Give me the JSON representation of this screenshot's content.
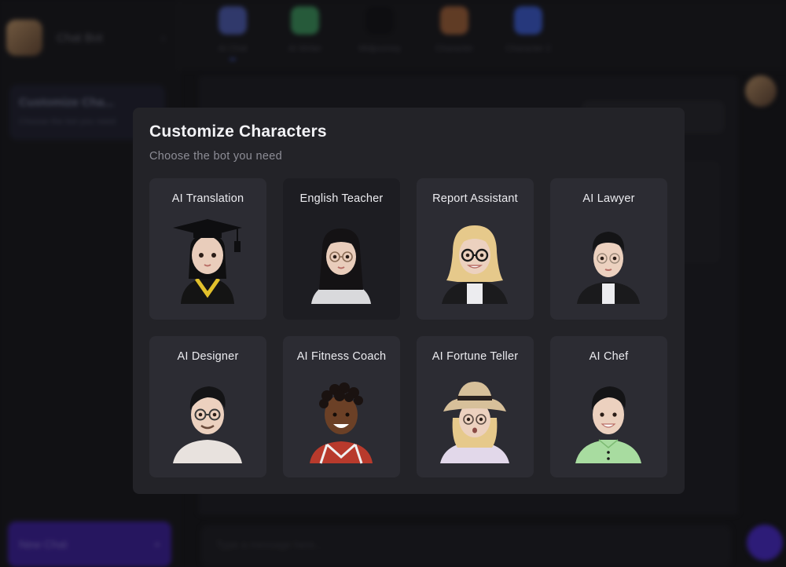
{
  "app": {
    "sidebar": {
      "name": "Chat Bot",
      "chat_title": "Customize Cha...",
      "chat_subtitle": "Choose the bot you need",
      "new_chat_label": "New Chat"
    },
    "bot_tabs": [
      {
        "label": "AI Chat",
        "color": "#4f5fb8"
      },
      {
        "label": "AI Writer",
        "color": "#3d9b60"
      },
      {
        "label": "Midjourney",
        "color": "#111114"
      },
      {
        "label": "Character",
        "color": "#a7643a"
      },
      {
        "label": "Character 2",
        "color": "#3c5ed8"
      }
    ],
    "input_placeholder": "Type a message here..."
  },
  "modal": {
    "title": "Customize Characters",
    "subtitle": "Choose the bot you need",
    "cards": [
      {
        "label": "AI Translation",
        "avatar": "graduate-avatar-icon"
      },
      {
        "label": "English Teacher",
        "avatar": "teacher-avatar-icon"
      },
      {
        "label": "Report Assistant",
        "avatar": "blonde-glasses-avatar-icon"
      },
      {
        "label": "AI Lawyer",
        "avatar": "lawyer-avatar-icon"
      },
      {
        "label": "AI Designer",
        "avatar": "designer-avatar-icon"
      },
      {
        "label": "AI Fitness Coach",
        "avatar": "fitness-coach-avatar-icon"
      },
      {
        "label": "AI Fortune Teller",
        "avatar": "fortune-teller-avatar-icon"
      },
      {
        "label": "AI Chef",
        "avatar": "chef-avatar-icon"
      }
    ]
  },
  "colors": {
    "modal_bg": "#232328",
    "card_bg": "#2c2c33",
    "accent": "#4a2ad0"
  }
}
